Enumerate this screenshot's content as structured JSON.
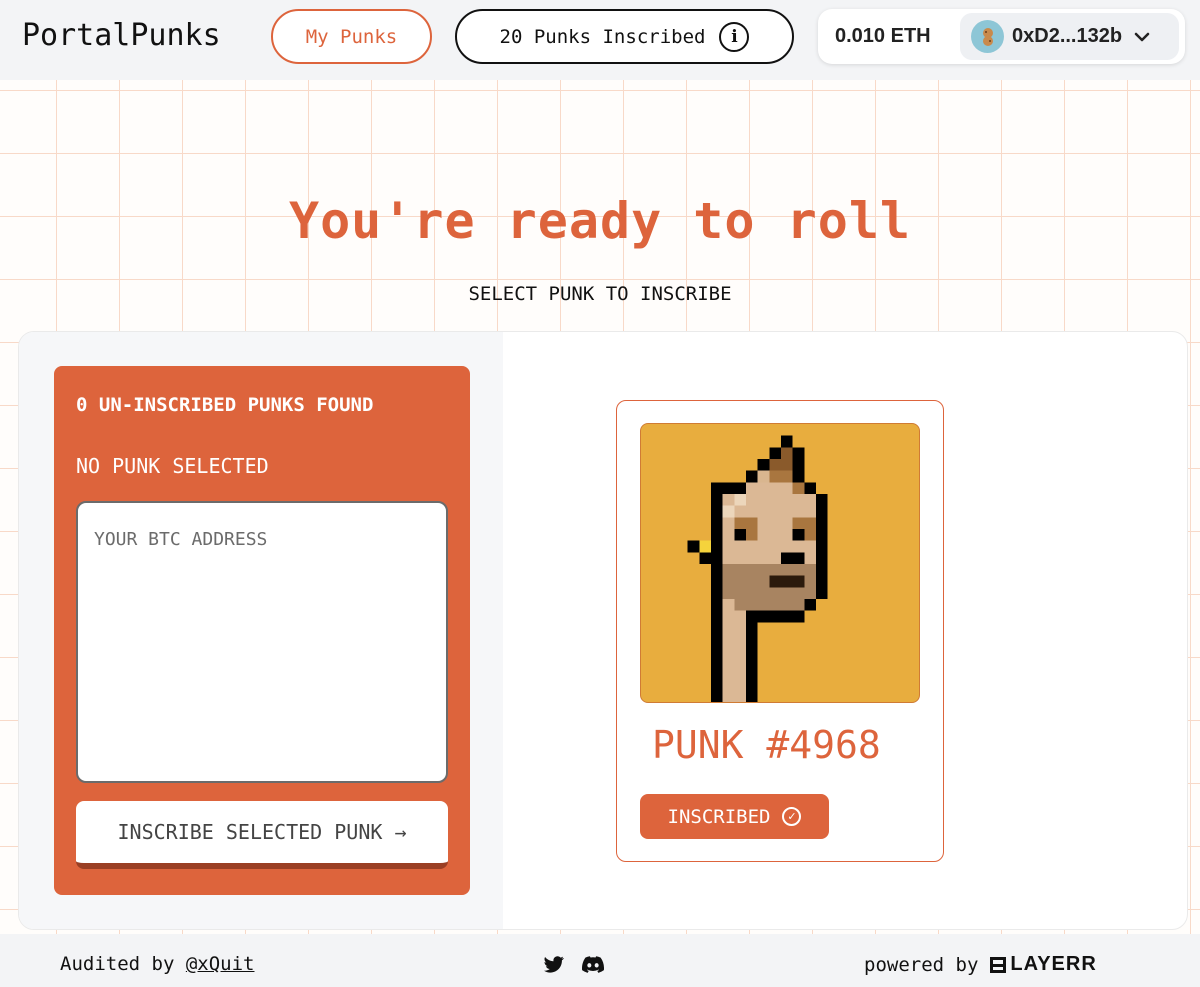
{
  "header": {
    "logo": "PortalPunks",
    "my_punks_label": "My Punks",
    "inscribed_count_label": "20 Punks Inscribed",
    "info_icon": "i",
    "balance": "0.010 ETH",
    "address": "0xD2...132b",
    "chevron": "⌄"
  },
  "hero": {
    "title": "You're ready to roll",
    "subtitle": "SELECT PUNK TO INSCRIBE"
  },
  "inscribe_panel": {
    "found_label": "0 UN-INSCRIBED PUNKS FOUND",
    "selection_label": "NO PUNK SELECTED",
    "btc_placeholder": "YOUR BTC ADDRESS",
    "btc_value": "",
    "inscribe_button_label": "INSCRIBE SELECTED PUNK →"
  },
  "punk_card": {
    "name": "PUNK #4968",
    "status": "INSCRIBED",
    "background_color": "#e8ad3e"
  },
  "footer": {
    "audited_prefix": "Audited by",
    "auditor": "@xQuit",
    "social_icons": [
      "twitter-icon",
      "discord-icon"
    ],
    "powered_by": "powered by",
    "brand": "LAYERR"
  },
  "colors": {
    "accent": "#dd643c",
    "dark": "#111111",
    "header_bg": "#f3f4f6"
  }
}
